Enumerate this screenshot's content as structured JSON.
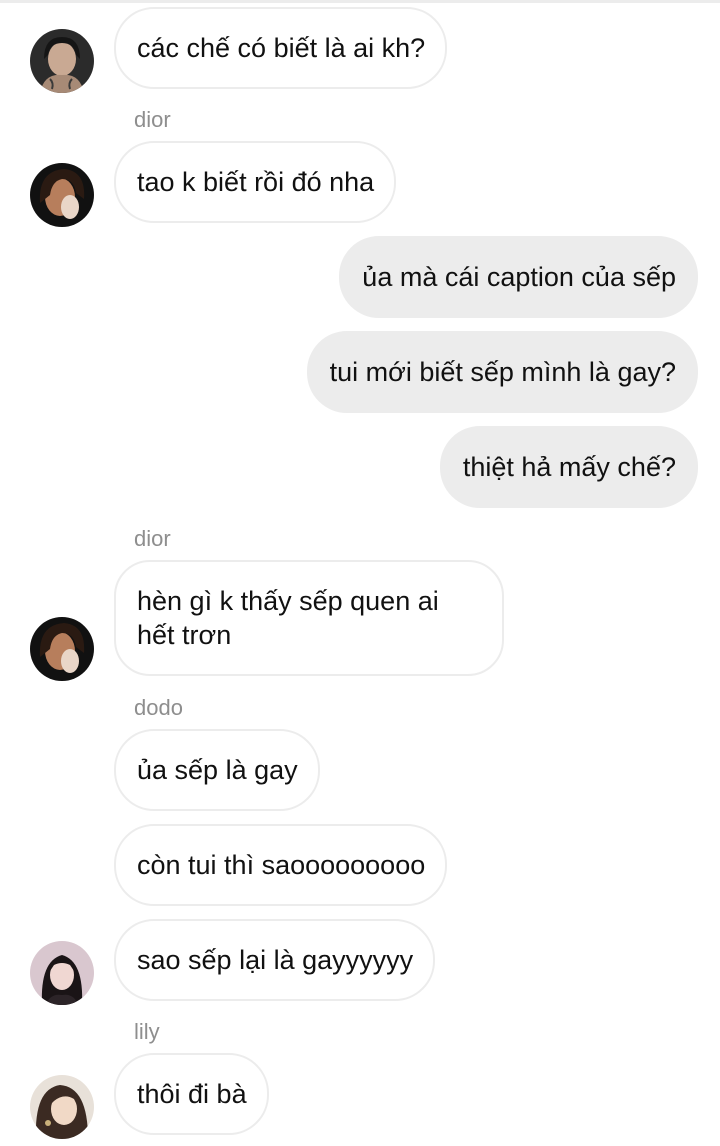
{
  "messages": [
    {
      "sender": "",
      "text": "các chế có biết là ai kh?",
      "direction": "incoming",
      "avatar": "avatar-tattoo-woman"
    },
    {
      "sender": "dior",
      "text": "tao k biết rồi đó nha",
      "direction": "incoming",
      "avatar": "avatar-dior"
    },
    {
      "sender": "",
      "text": "ủa mà cái caption của sếp",
      "direction": "outgoing"
    },
    {
      "sender": "",
      "text": "tui mới biết sếp mình là gay?",
      "direction": "outgoing"
    },
    {
      "sender": "",
      "text": "thiệt hả mấy chế?",
      "direction": "outgoing"
    },
    {
      "sender": "dior",
      "text": "hèn gì k thấy sếp quen ai hết trơn",
      "direction": "incoming",
      "avatar": "avatar-dior"
    },
    {
      "sender": "dodo",
      "text": "ủa sếp là gay",
      "direction": "incoming"
    },
    {
      "sender": "",
      "text": "còn tui thì saooooooooo",
      "direction": "incoming"
    },
    {
      "sender": "",
      "text": "sao sếp lại là gayyyyyy",
      "direction": "incoming",
      "avatar": "avatar-dodo"
    },
    {
      "sender": "lily",
      "text": "thôi đi bà",
      "direction": "incoming",
      "avatar": "avatar-lily"
    }
  ],
  "colors": {
    "incoming_bubble": "#ffffff",
    "incoming_border": "#ececec",
    "outgoing_bubble": "#ececec",
    "sender_name": "#8e8e8e",
    "text": "#111111"
  }
}
